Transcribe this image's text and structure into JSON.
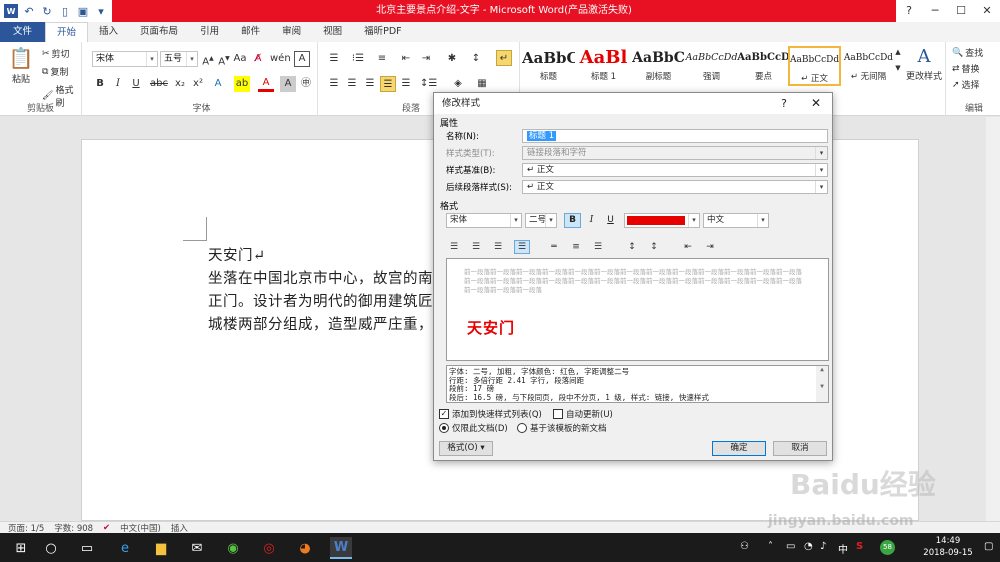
{
  "window": {
    "title": "北京主要景点介绍-文字 - Microsoft Word(产品激活失败)",
    "controls": [
      "?",
      "─",
      "☐",
      "✕"
    ]
  },
  "ribbon": {
    "tabs": [
      "文件",
      "开始",
      "插入",
      "页面布局",
      "引用",
      "邮件",
      "审阅",
      "视图",
      "福昕PDF"
    ],
    "active_tab": "开始",
    "clipboard": {
      "paste": "粘贴",
      "cut": "剪切",
      "copy": "复制",
      "format_painter": "格式刷",
      "label": "剪贴板"
    },
    "font": {
      "name": "宋体",
      "size": "五号",
      "label": "字体"
    },
    "paragraph": {
      "label": "段落"
    },
    "styles": {
      "items": [
        {
          "sample": "AaBbC",
          "name": "标题"
        },
        {
          "sample": "AaBl",
          "name": "标题 1"
        },
        {
          "sample": "AaBbC",
          "name": "副标题"
        },
        {
          "sample": "AaBbCcDd",
          "name": "强调"
        },
        {
          "sample": "AaBbCcD",
          "name": "要点"
        },
        {
          "sample": "AaBbCcDd",
          "name": "↵ 正文"
        },
        {
          "sample": "AaBbCcDd",
          "name": "↵ 无间隔"
        }
      ],
      "change_styles": "更改样式"
    },
    "editing": {
      "find": "查找",
      "replace": "替换",
      "select": "选择",
      "label": "编辑"
    }
  },
  "document": {
    "lines": [
      "天安门↵",
      "坐落在中国北京市中心，故宫的南端",
      "正门。设计者为明代的御用建筑匠师",
      "城楼两部分组成，造型威严庄重，气"
    ]
  },
  "statusbar": {
    "page": "页面: 1/5",
    "words": "字数: 908",
    "language": "中文(中国)",
    "mode": "插入"
  },
  "dialog": {
    "title": "修改样式",
    "help": "?",
    "close": "✕",
    "section_properties": "属性",
    "name_label": "名称(N):",
    "name_value": "标题 1",
    "style_type_label": "样式类型(T):",
    "style_type_value": "链接段落和字符",
    "based_on_label": "样式基准(B):",
    "based_on_value": "↵ 正文",
    "following_label": "后续段落样式(S):",
    "following_value": "↵ 正文",
    "section_format": "格式",
    "font_name": "宋体",
    "font_size": "二号",
    "bold": "B",
    "italic": "I",
    "underline": "U",
    "font_color": "#e60000",
    "script": "中文",
    "preview_grey": "前一段落前一段落前一段落前一段落前一段落前一段落前一段落前一段落前一段落前一段落前一段落前一段落前一段落前一段落前一段落前一段落前一段落前一段落前一段落前一段落前一段落前一段落前一段落前一段落前一段落前一段落前一段落前一段落前一段落",
    "preview_text": "天安门",
    "description": [
      "字体: 二号, 加粗, 字体颜色: 红色, 字距调整二号",
      "    行距: 多倍行距 2.41 字行, 段落间距",
      "    段前: 17 磅",
      "    段后: 16.5 磅, 与下段同页, 段中不分页, 1 级, 样式: 链接, 快速样式"
    ],
    "add_to_quick": "添加到快速样式列表(Q)",
    "auto_update": "自动更新(U)",
    "only_this_doc": "仅限此文档(D)",
    "new_docs_template": "基于该模板的新文档",
    "format_btn": "格式(O) ▾",
    "ok": "确定",
    "cancel": "取消"
  },
  "taskbar": {
    "time": "14:49",
    "date": "2018-09-15",
    "ime": "中",
    "badge": "58"
  },
  "watermark": {
    "text": "Baidu经验",
    "sub": "jingyan.baidu.com"
  }
}
